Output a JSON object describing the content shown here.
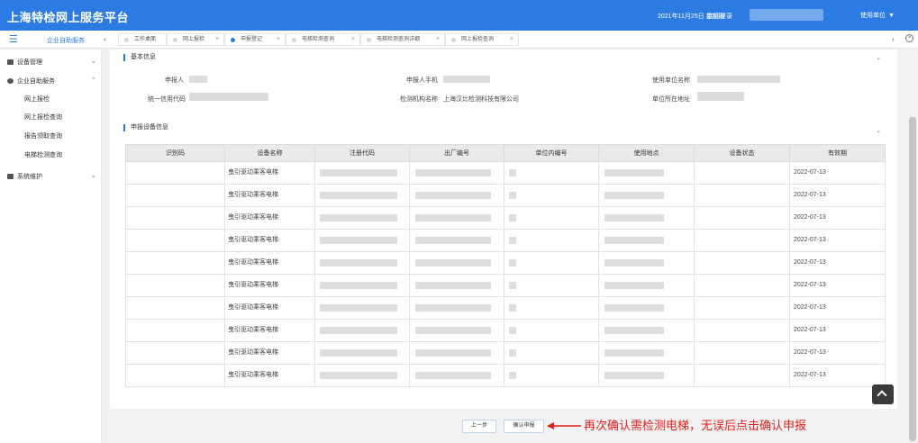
{
  "header": {
    "app_title": "上海特检网上服务平台",
    "date": "2021年11月25日 星期四",
    "welcome": "欢迎登录",
    "role_menu": "使用单位"
  },
  "tabbar": {
    "section_label": "企业自助服务",
    "tabs": [
      {
        "label": "工作桌面",
        "active": false,
        "closable": false
      },
      {
        "label": "网上报检",
        "active": false,
        "closable": true
      },
      {
        "label": "申报登记",
        "active": true,
        "closable": true
      },
      {
        "label": "电梯检测查询",
        "active": false,
        "closable": true
      },
      {
        "label": "电梯检测查询详细",
        "active": false,
        "closable": true
      },
      {
        "label": "网上报检查询",
        "active": false,
        "closable": true
      }
    ]
  },
  "sidebar": {
    "groups": [
      {
        "label": "设备管理",
        "icon": "briefcase-icon"
      },
      {
        "label": "企业自助服务",
        "icon": "gear-icon"
      },
      {
        "label": "系统维护",
        "icon": "monitor-icon"
      }
    ],
    "sub_items": [
      "网上报检",
      "网上报检查询",
      "报告领取查询",
      "电梯检测查询"
    ]
  },
  "basic_info": {
    "title": "基本信息",
    "applicant_label": "申报人",
    "applicant_phone_label": "申报人手机",
    "user_unit_label": "使用单位名称",
    "credit_code_label": "统一信用代码",
    "agency_label": "检测机构名称",
    "agency_value": "上海汉比检测科技有限公司",
    "unit_address_label": "单位所在地址"
  },
  "equipment": {
    "title": "申报设备信息",
    "columns": [
      "识别码",
      "设备名称",
      "注册代码",
      "出厂编号",
      "单位内编号",
      "使用地点",
      "设备状态",
      "有效期"
    ],
    "rows": [
      {
        "name": "曳引驱动乘客电梯",
        "expiry": "2022-07-13"
      },
      {
        "name": "曳引驱动乘客电梯",
        "expiry": "2022-07-13"
      },
      {
        "name": "曳引驱动乘客电梯",
        "expiry": "2022-07-13"
      },
      {
        "name": "曳引驱动乘客电梯",
        "expiry": "2022-07-13"
      },
      {
        "name": "曳引驱动乘客电梯",
        "expiry": "2022-07-13"
      },
      {
        "name": "曳引驱动乘客电梯",
        "expiry": "2022-07-13"
      },
      {
        "name": "曳引驱动乘客电梯",
        "expiry": "2022-07-13"
      },
      {
        "name": "曳引驱动乘客电梯",
        "expiry": "2022-07-13"
      },
      {
        "name": "曳引驱动乘客电梯",
        "expiry": "2022-07-13"
      },
      {
        "name": "曳引驱动乘客电梯",
        "expiry": "2022-07-13"
      }
    ]
  },
  "actions": {
    "prev_label": "上一步",
    "confirm_label": "确认申报"
  },
  "annotation": "再次确认需检测电梯，无误后点击确认申报",
  "colors": {
    "primary": "#2b7be3",
    "annotation": "#e3201b"
  }
}
